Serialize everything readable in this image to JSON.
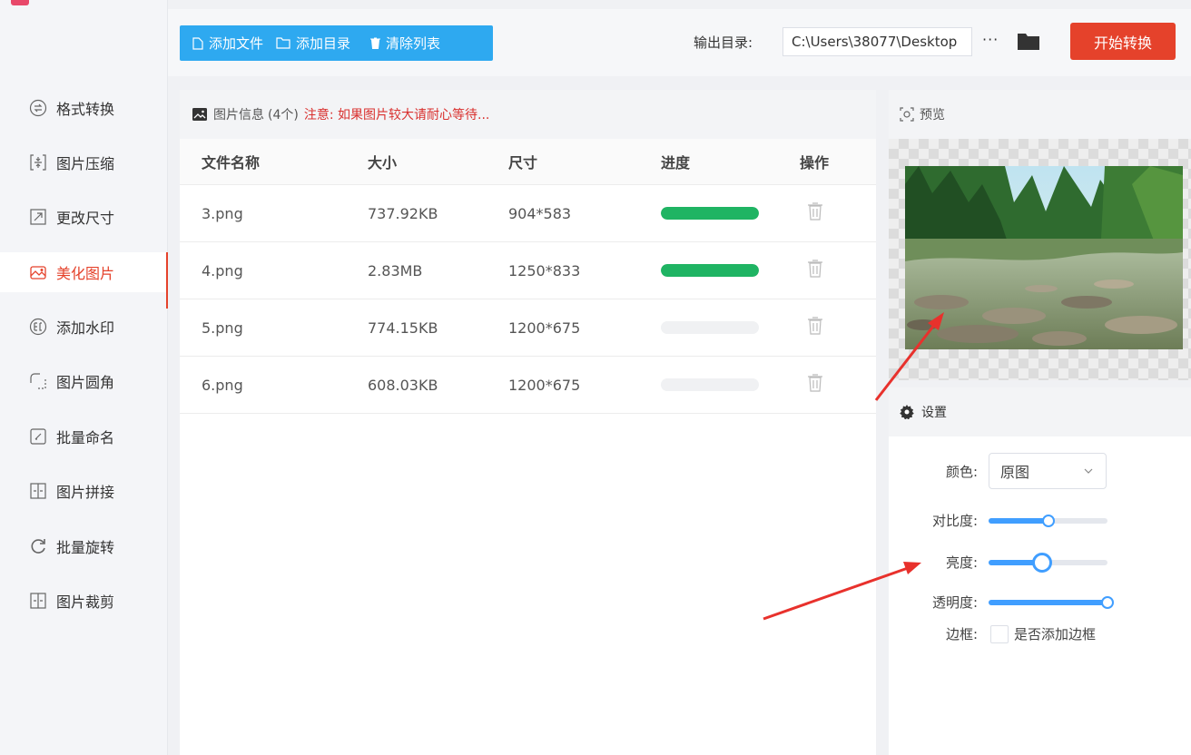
{
  "sidebar": {
    "items": [
      {
        "label": "格式转换",
        "icon": "swap-circle-icon",
        "active": false
      },
      {
        "label": "图片压缩",
        "icon": "compress-icon",
        "active": false
      },
      {
        "label": "更改尺寸",
        "icon": "resize-icon",
        "active": false
      },
      {
        "label": "美化图片",
        "icon": "beautify-icon",
        "active": true
      },
      {
        "label": "添加水印",
        "icon": "watermark-icon",
        "active": false
      },
      {
        "label": "图片圆角",
        "icon": "rounded-corner-icon",
        "active": false
      },
      {
        "label": "批量命名",
        "icon": "rename-icon",
        "active": false
      },
      {
        "label": "图片拼接",
        "icon": "stitch-icon",
        "active": false
      },
      {
        "label": "批量旋转",
        "icon": "rotate-icon",
        "active": false
      },
      {
        "label": "图片裁剪",
        "icon": "crop-icon",
        "active": false
      }
    ]
  },
  "toolbar": {
    "add_file": "添加文件",
    "add_folder": "添加目录",
    "clear_list": "清除列表",
    "output_label": "输出目录:",
    "output_path": "C:\\Users\\38077\\Desktop",
    "more": "···",
    "start": "开始转换"
  },
  "file_panel": {
    "title": "图片信息",
    "count": "(4个)",
    "notice": "注意: 如果图片较大请耐心等待...",
    "columns": [
      "文件名称",
      "大小",
      "尺寸",
      "进度",
      "操作"
    ],
    "rows": [
      {
        "name": "3.png",
        "size": "737.92KB",
        "dims": "904*583",
        "progress": 1.0
      },
      {
        "name": "4.png",
        "size": "2.83MB",
        "dims": "1250*833",
        "progress": 1.0
      },
      {
        "name": "5.png",
        "size": "774.15KB",
        "dims": "1200*675",
        "progress": 0
      },
      {
        "name": "6.png",
        "size": "608.03KB",
        "dims": "1200*675",
        "progress": 0
      }
    ]
  },
  "preview": {
    "title": "预览"
  },
  "settings": {
    "title": "设置",
    "color_label": "颜色:",
    "color_value": "原图",
    "contrast_label": "对比度:",
    "contrast_value": 0.5,
    "brightness_label": "亮度:",
    "brightness_value": 0.45,
    "opacity_label": "透明度:",
    "opacity_value": 1.0,
    "border_label": "边框:",
    "border_checkbox": "是否添加边框",
    "border_checked": false
  },
  "colors": {
    "accent": "#e5422b",
    "toolbar_blue": "#2ea9f0",
    "progress_green": "#1fb463",
    "slider_blue": "#409eff"
  }
}
